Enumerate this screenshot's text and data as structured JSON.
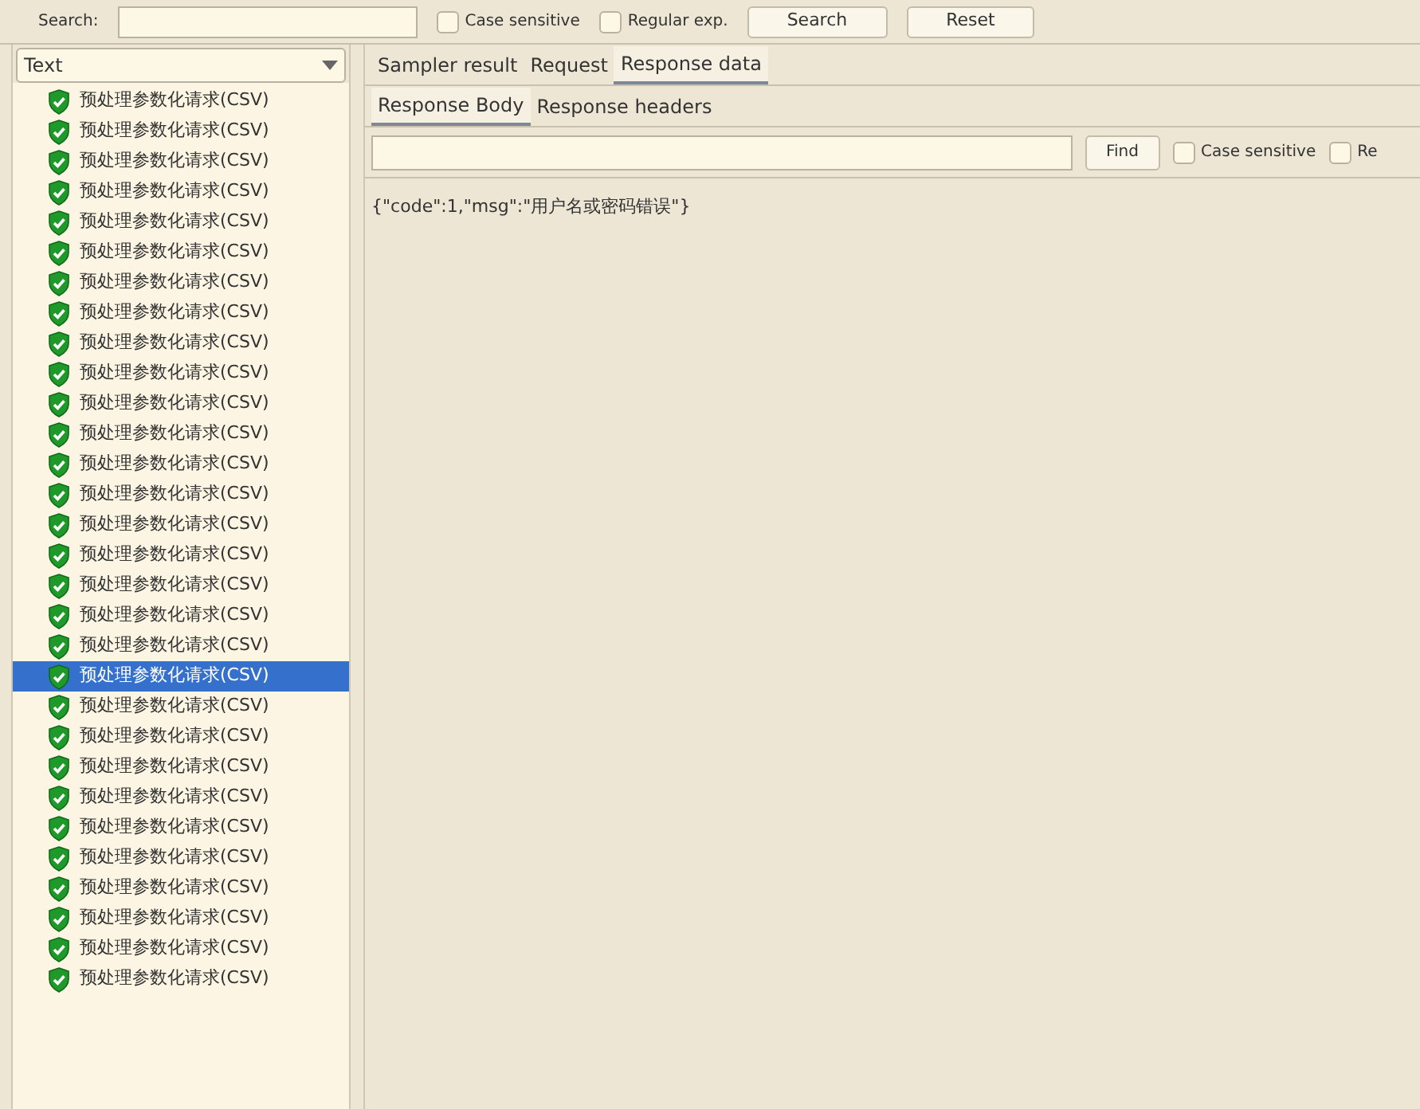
{
  "search_bar": {
    "label": "Search:",
    "case_sensitive": {
      "label": "Case sensitive",
      "checked": false
    },
    "regular_exp": {
      "label": "Regular exp.",
      "checked": false
    },
    "buttons": [
      "Search",
      "Reset"
    ]
  },
  "renderer": {
    "value": "Text"
  },
  "results": [
    {
      "label": "预处理参数化请求(CSV)",
      "selected": false
    },
    {
      "label": "预处理参数化请求(CSV)",
      "selected": false
    },
    {
      "label": "预处理参数化请求(CSV)",
      "selected": false
    },
    {
      "label": "预处理参数化请求(CSV)",
      "selected": false
    },
    {
      "label": "预处理参数化请求(CSV)",
      "selected": false
    },
    {
      "label": "预处理参数化请求(CSV)",
      "selected": false
    },
    {
      "label": "预处理参数化请求(CSV)",
      "selected": false
    },
    {
      "label": "预处理参数化请求(CSV)",
      "selected": false
    },
    {
      "label": "预处理参数化请求(CSV)",
      "selected": false
    },
    {
      "label": "预处理参数化请求(CSV)",
      "selected": false
    },
    {
      "label": "预处理参数化请求(CSV)",
      "selected": false
    },
    {
      "label": "预处理参数化请求(CSV)",
      "selected": false
    },
    {
      "label": "预处理参数化请求(CSV)",
      "selected": false
    },
    {
      "label": "预处理参数化请求(CSV)",
      "selected": false
    },
    {
      "label": "预处理参数化请求(CSV)",
      "selected": false
    },
    {
      "label": "预处理参数化请求(CSV)",
      "selected": false
    },
    {
      "label": "预处理参数化请求(CSV)",
      "selected": false
    },
    {
      "label": "预处理参数化请求(CSV)",
      "selected": false
    },
    {
      "label": "预处理参数化请求(CSV)",
      "selected": false
    },
    {
      "label": "预处理参数化请求(CSV)",
      "selected": true
    },
    {
      "label": "预处理参数化请求(CSV)",
      "selected": false
    },
    {
      "label": "预处理参数化请求(CSV)",
      "selected": false
    },
    {
      "label": "预处理参数化请求(CSV)",
      "selected": false
    },
    {
      "label": "预处理参数化请求(CSV)",
      "selected": false
    },
    {
      "label": "预处理参数化请求(CSV)",
      "selected": false
    },
    {
      "label": "预处理参数化请求(CSV)",
      "selected": false
    },
    {
      "label": "预处理参数化请求(CSV)",
      "selected": false
    },
    {
      "label": "预处理参数化请求(CSV)",
      "selected": false
    },
    {
      "label": "预处理参数化请求(CSV)",
      "selected": false
    },
    {
      "label": "预处理参数化请求(CSV)",
      "selected": false
    }
  ],
  "tabs": [
    {
      "label": "Sampler result",
      "selected": false
    },
    {
      "label": "Request",
      "selected": false
    },
    {
      "label": "Response data",
      "selected": true
    }
  ],
  "sub_tabs": [
    {
      "label": "Response Body",
      "selected": true
    },
    {
      "label": "Response headers",
      "selected": false
    }
  ],
  "find_bar": {
    "button": "Find",
    "case_sensitive": {
      "label": "Case sensitive",
      "checked": false
    },
    "option_2": {
      "label": "Re",
      "checked": false
    }
  },
  "response_body": "{\"code\":1,\"msg\":\"用户名或密码错误\"}"
}
